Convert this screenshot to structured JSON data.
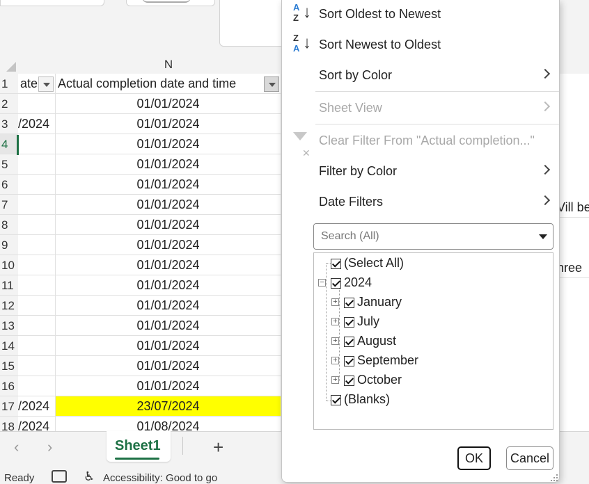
{
  "spreadsheet": {
    "column_header": "N",
    "header_row_m": "ate",
    "header_row_n": "Actual completion date and time",
    "rows": [
      {
        "num": "1"
      },
      {
        "num": "2",
        "m": "",
        "n": "01/01/2024"
      },
      {
        "num": "3",
        "m": "/2024",
        "n": "01/01/2024"
      },
      {
        "num": "4",
        "m": "",
        "n": "01/01/2024"
      },
      {
        "num": "5",
        "m": "",
        "n": "01/01/2024"
      },
      {
        "num": "6",
        "m": "",
        "n": "01/01/2024"
      },
      {
        "num": "7",
        "m": "",
        "n": "01/01/2024"
      },
      {
        "num": "8",
        "m": "",
        "n": "01/01/2024"
      },
      {
        "num": "9",
        "m": "",
        "n": "01/01/2024"
      },
      {
        "num": "10",
        "m": "",
        "n": "01/01/2024"
      },
      {
        "num": "11",
        "m": "",
        "n": "01/01/2024"
      },
      {
        "num": "12",
        "m": "",
        "n": "01/01/2024"
      },
      {
        "num": "13",
        "m": "",
        "n": "01/01/2024"
      },
      {
        "num": "14",
        "m": "",
        "n": "01/01/2024"
      },
      {
        "num": "15",
        "m": "",
        "n": "01/01/2024"
      },
      {
        "num": "16",
        "m": "",
        "n": "01/01/2024"
      },
      {
        "num": "17",
        "m": "/2024",
        "n": "23/07/2024"
      },
      {
        "num": "18",
        "m": "/2024",
        "n": "01/08/2024"
      }
    ],
    "highlight_color": "#ffff00",
    "right_fragments": {
      "row7": "Vill be",
      "row10": "hree"
    }
  },
  "sheet_tabs": {
    "active": "Sheet1",
    "prev_icon": "‹",
    "next_icon": "›",
    "add_icon": "+"
  },
  "status_bar": {
    "ready": "Ready",
    "accessibility": "Accessibility: Good to go"
  },
  "filter_menu": {
    "sort_asc": "Sort Oldest to Newest",
    "sort_desc": "Sort Newest to Oldest",
    "sort_by_color": "Sort by Color",
    "sheet_view": "Sheet View",
    "clear_filter": "Clear Filter From \"Actual completion...\"",
    "filter_by_color": "Filter by Color",
    "date_filters": "Date Filters",
    "search_placeholder": "Search (All)",
    "tree": {
      "select_all": "(Select All)",
      "year": "2024",
      "months": [
        "January",
        "July",
        "August",
        "September",
        "October"
      ],
      "blanks": "(Blanks)"
    },
    "ok": "OK",
    "cancel": "Cancel"
  }
}
